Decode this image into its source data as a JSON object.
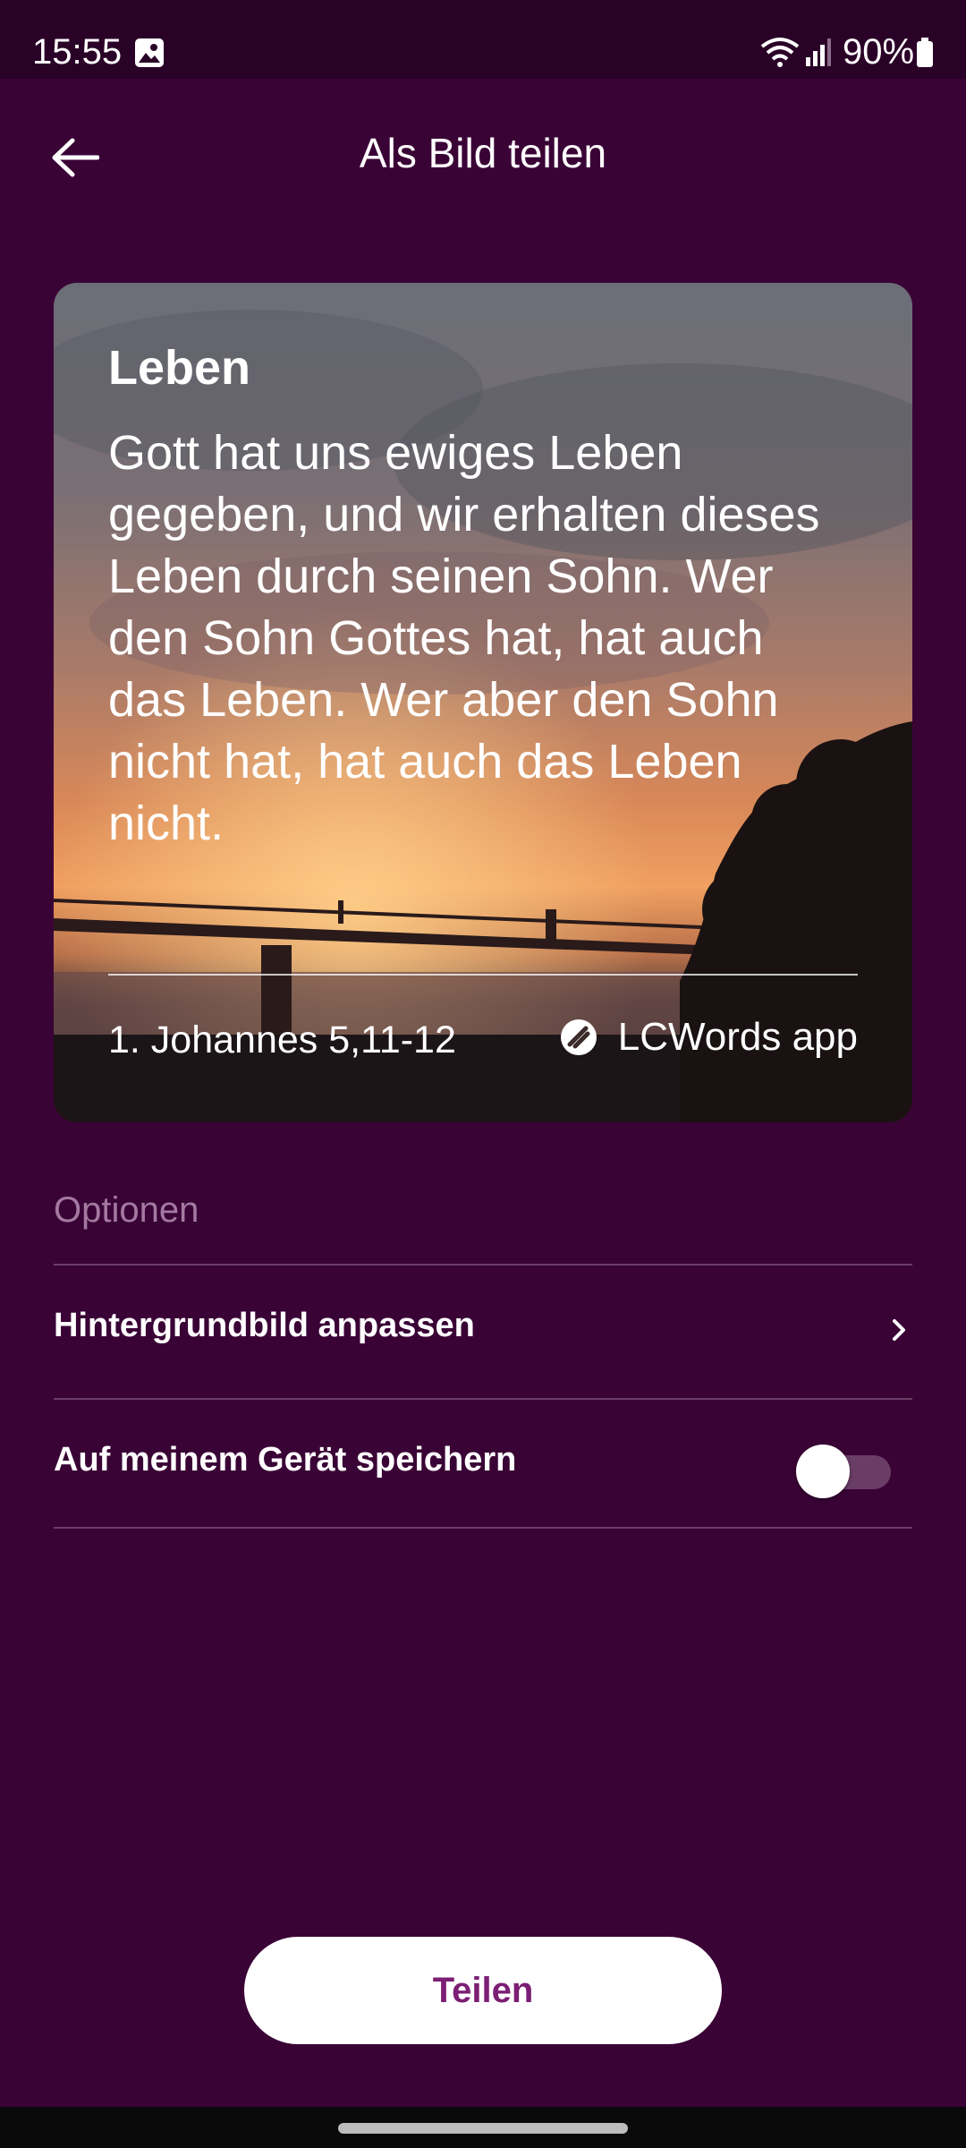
{
  "status_bar": {
    "time": "15:55",
    "battery": "90%",
    "icons": [
      "gallery-icon",
      "wifi-icon",
      "signal-icon",
      "battery-icon"
    ]
  },
  "header": {
    "title": "Als Bild teilen",
    "back_icon": "arrow-left-icon"
  },
  "card": {
    "heading": "Leben",
    "verse": "Gott hat uns ewiges Leben gegeben, und wir erhalten dieses Leben durch seinen Sohn. Wer den Sohn Gottes hat, hat auch das Leben. Wer aber den Sohn nicht hat, hat auch das Leben nicht.",
    "reference": "1. Johannes 5,11-12",
    "brand": "LCWords app",
    "background": "sunset-over-sea-with-bridge"
  },
  "options": {
    "section_label": "Optionen",
    "items": [
      {
        "label": "Hintergrundbild anpassen",
        "control": "chevron-right-icon"
      },
      {
        "label": "Auf meinem Gerät speichern",
        "control": "toggle",
        "enabled": false
      }
    ]
  },
  "share_button": {
    "label": "Teilen"
  },
  "colors": {
    "background": "#3a0336",
    "status_bar": "#2a0127",
    "muted_text": "#a47aa0",
    "divider": "#6a3d66",
    "button_text": "#7b1f75"
  }
}
